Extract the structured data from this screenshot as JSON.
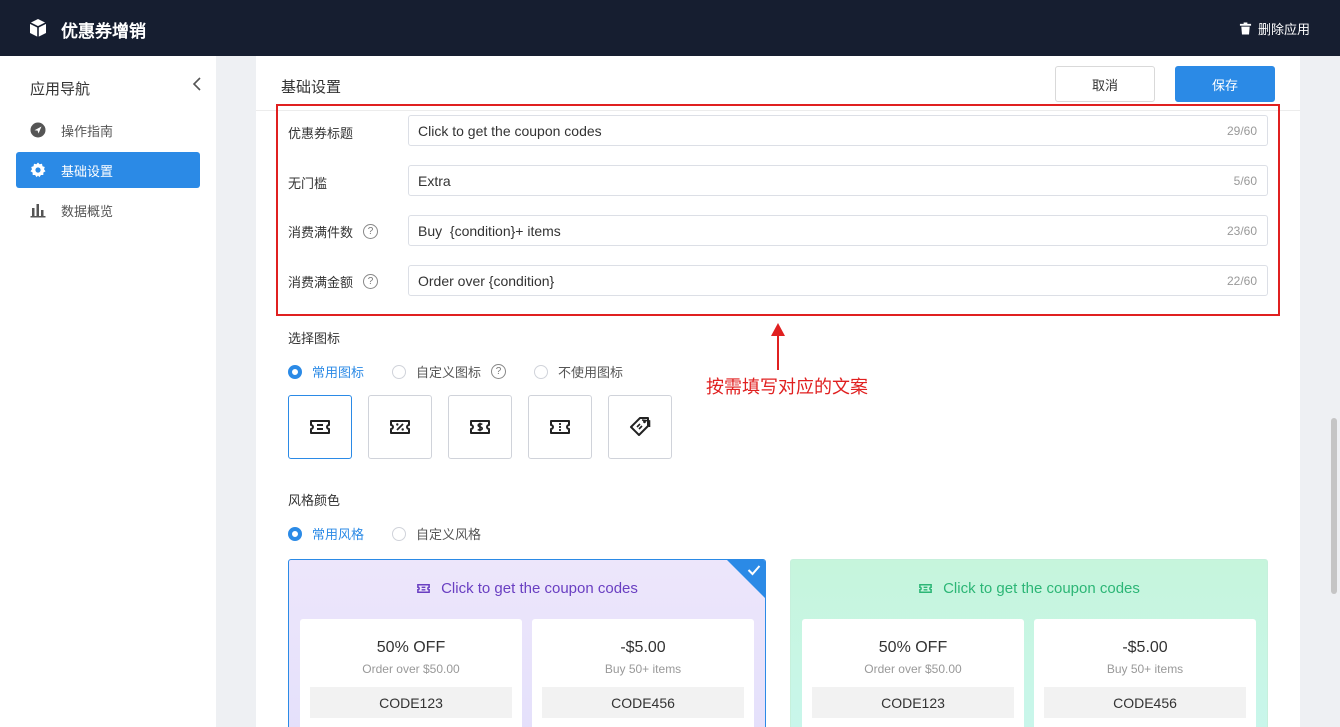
{
  "header": {
    "app_title": "优惠券增销",
    "delete_label": "删除应用"
  },
  "sidebar": {
    "title": "应用导航",
    "items": [
      {
        "label": "操作指南",
        "icon": "navigation-arrow-icon",
        "active": false
      },
      {
        "label": "基础设置",
        "icon": "gear-icon",
        "active": true
      },
      {
        "label": "数据概览",
        "icon": "bar-chart-icon",
        "active": false
      }
    ]
  },
  "main": {
    "title": "基础设置",
    "cancel_label": "取消",
    "save_label": "保存",
    "fields": [
      {
        "label": "优惠券标题",
        "value": "Click to get the coupon codes",
        "count": "29/60",
        "help": false
      },
      {
        "label": "无门槛",
        "value": "Extra",
        "count": "5/60",
        "help": false
      },
      {
        "label": "消费满件数",
        "value": "Buy  {condition}+ items",
        "count": "23/60",
        "help": true
      },
      {
        "label": "消费满金额",
        "value": "Order over {condition}",
        "count": "22/60",
        "help": true
      }
    ],
    "icon_section": {
      "title": "选择图标",
      "options": [
        {
          "label": "常用图标",
          "checked": true
        },
        {
          "label": "自定义图标",
          "checked": false,
          "help": true
        },
        {
          "label": "不使用图标",
          "checked": false
        }
      ],
      "icons": [
        "ticket-icon",
        "percent-ticket-icon",
        "dollar-ticket-icon",
        "plain-ticket-icon",
        "price-tag-icon"
      ]
    },
    "style_section": {
      "title": "风格颜色",
      "options": [
        {
          "label": "常用风格",
          "checked": true
        },
        {
          "label": "自定义风格",
          "checked": false
        }
      ],
      "cards": [
        {
          "theme": "purple",
          "accent": "#6a3fc2",
          "selected": true,
          "title": "Click to get the coupon codes",
          "coupons": [
            {
              "amount": "50% OFF",
              "condition": "Order over $50.00",
              "code": "CODE123"
            },
            {
              "amount": "-$5.00",
              "condition": "Buy 50+ items",
              "code": "CODE456"
            }
          ]
        },
        {
          "theme": "green",
          "accent": "#2cb676",
          "selected": false,
          "title": "Click to get the coupon codes",
          "coupons": [
            {
              "amount": "50% OFF",
              "condition": "Order over $50.00",
              "code": "CODE123"
            },
            {
              "amount": "-$5.00",
              "condition": "Buy 50+ items",
              "code": "CODE456"
            }
          ]
        }
      ]
    }
  },
  "annotation": {
    "text": "按需填写对应的文案",
    "color": "#e02020"
  },
  "colors": {
    "primary": "#2b8ae6",
    "header_bg": "#161e30"
  }
}
